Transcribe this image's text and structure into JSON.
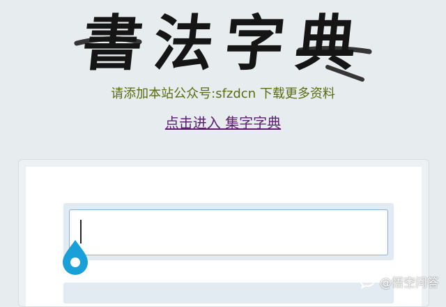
{
  "header": {
    "logo_text": "書法字典",
    "subtitle": "请添加本站公众号:sfzdcn 下载更多资料",
    "enter_link": "点击进入 集字字典"
  },
  "search": {
    "value": "",
    "placeholder": ""
  },
  "watermark": {
    "text": "@悟空问答"
  },
  "colors": {
    "page_background": "#e7ecef",
    "subtitle": "#5a6b10",
    "link": "#5a1f75",
    "input_border": "#8cb3d9",
    "handle": "#1aa0d8"
  }
}
